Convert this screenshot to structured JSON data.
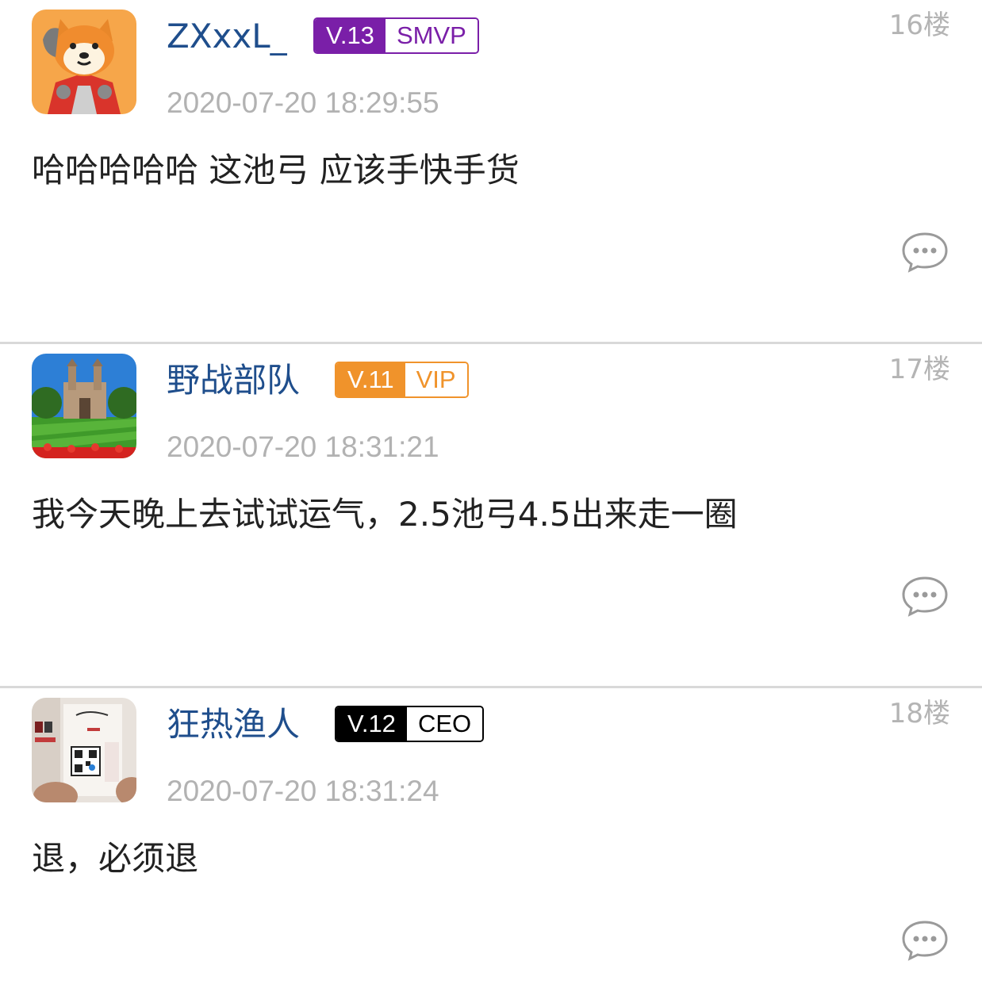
{
  "posts": [
    {
      "username": "ZXxxL_",
      "level": "V.13",
      "role": "SMVP",
      "badge_color": "#7a1fa8",
      "floor": "16楼",
      "time": "2020-07-20 18:29:55",
      "content": "哈哈哈哈哈 这池弓 应该手快手货",
      "avatar_icon": "shiba-dog-avatar",
      "reply_icon": "comment-bubble-icon"
    },
    {
      "username": "野战部队",
      "level": "V.11",
      "role": "VIP",
      "badge_color": "#f0932b",
      "floor": "17楼",
      "time": "2020-07-20 18:31:21",
      "content": "我今天晚上去试试运气，2.5池弓4.5出来走一圈",
      "avatar_icon": "campus-building-avatar",
      "reply_icon": "comment-bubble-icon"
    },
    {
      "username": "狂热渔人",
      "level": "V.12",
      "role": "CEO",
      "badge_color": "#000000",
      "floor": "18楼",
      "time": "2020-07-20 18:31:24",
      "content": "退，必须退",
      "avatar_icon": "qr-code-poster-avatar",
      "reply_icon": "comment-bubble-icon"
    }
  ]
}
